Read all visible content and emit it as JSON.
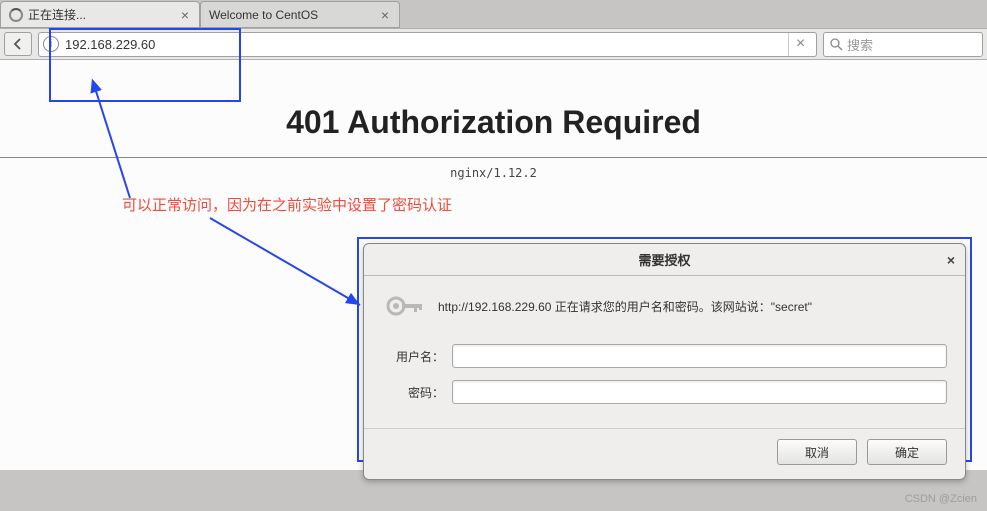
{
  "tabs": [
    {
      "title": "正在连接...",
      "loading": true
    },
    {
      "title": "Welcome to CentOS",
      "loading": false
    }
  ],
  "url": "192.168.229.60",
  "search_placeholder": "搜索",
  "page": {
    "title": "401 Authorization Required",
    "server": "nginx/1.12.2"
  },
  "annotation": "可以正常访问，因为在之前实验中设置了密码认证",
  "dialog": {
    "title": "需要授权",
    "message": "http://192.168.229.60 正在请求您的用户名和密码。该网站说：\"secret\"",
    "username_label": "用户名：",
    "password_label": "密码：",
    "cancel": "取消",
    "ok": "确定"
  },
  "watermark": "CSDN @Zcien"
}
